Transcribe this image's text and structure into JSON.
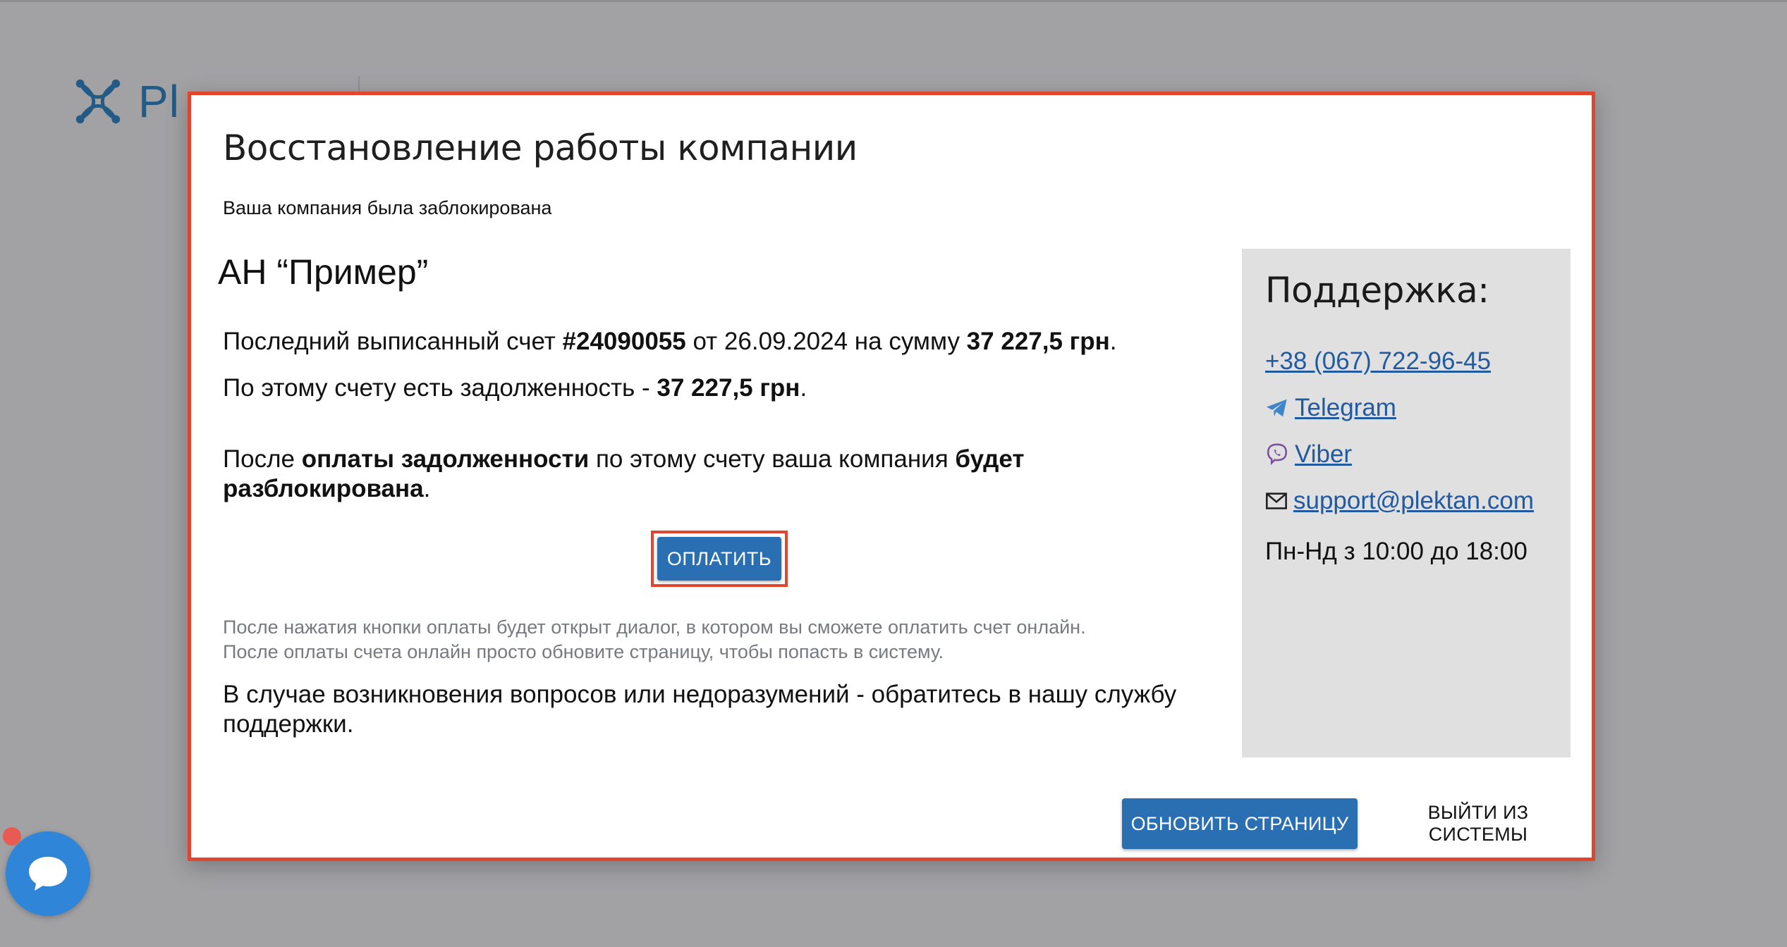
{
  "background": {
    "logo_text": "Pl"
  },
  "modal": {
    "title": "Восстановление работы компании",
    "subtitle": "Ваша компания была заблокирована",
    "company_name": "АН “Пример”",
    "invoice": {
      "prefix": "Последний выписанный счет ",
      "number": "#24090055",
      "date_part": " от 26.09.2024 на сумму ",
      "amount": "37 227,5 грн",
      "suffix": "."
    },
    "debt": {
      "prefix": "По этому счету есть задолженность - ",
      "amount": "37 227,5 грн",
      "suffix": "."
    },
    "unlock": {
      "part1": "После ",
      "bold1": "оплаты задолженности",
      "part2": " по этому счету ваша компания ",
      "bold2": "будет разблокирована",
      "part3": "."
    },
    "pay_button_label": "ОПЛАТИТЬ",
    "hint_line1": "После нажатия кнопки оплаты будет открыт диалог, в котором вы сможете оплатить счет онлайн.",
    "hint_line2": "После оплаты счета онлайн просто обновите страницу, чтобы попасть в систему.",
    "contact_note": "В случае возникновения вопросов или недоразумений - обратитесь в нашу службу поддержки.",
    "refresh_button_label": "ОБНОВИТЬ СТРАНИЦУ",
    "logout_button_label": "ВЫЙТИ ИЗ СИСТЕМЫ"
  },
  "support": {
    "title": "Поддержка:",
    "phone": "+38 (067) 722-96-45",
    "telegram_label": "Telegram",
    "telegram_icon": "telegram-icon",
    "viber_label": "Viber",
    "viber_icon": "viber-icon",
    "email": "support@plektan.com",
    "email_icon": "mail-icon",
    "hours": "Пн-Нд з 10:00 до 18:00"
  },
  "colors": {
    "accent": "#2b6fb3",
    "highlight_border": "#e2452d",
    "link": "#215aa0",
    "overlay": "#a2a2a5",
    "support_panel": "#e0e0e0",
    "chat_widget": "#2f86d8"
  }
}
